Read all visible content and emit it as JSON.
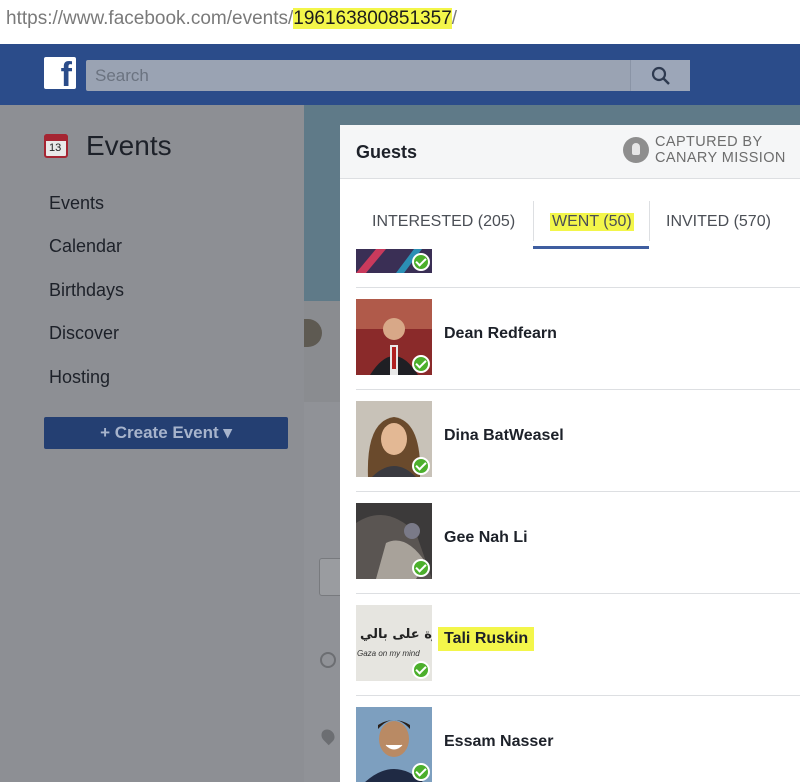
{
  "browser": {
    "url_prefix": "https://www.facebook.com/",
    "url_path": "events/",
    "url_id": "196163800851357",
    "url_suffix": "/"
  },
  "topbar": {
    "logo_letter": "f",
    "search_placeholder": "Search"
  },
  "sidebar": {
    "calendar_day": "13",
    "title": "Events",
    "items": [
      "Events",
      "Calendar",
      "Birthdays",
      "Discover",
      "Hosting"
    ],
    "create_button": "+ Create Event ▾"
  },
  "modal": {
    "title": "Guests",
    "stamp_line1": "CAPTURED BY",
    "stamp_line2": "CANARY MISSION",
    "tabs": [
      {
        "label": "INTERESTED (205)",
        "active": false
      },
      {
        "label": "WENT (50)",
        "active": true
      },
      {
        "label": "INVITED (570)",
        "active": false
      }
    ],
    "guests": [
      {
        "name": "Dean Redfearn"
      },
      {
        "name": "Dina BatWeasel"
      },
      {
        "name": "Gee Nah Li"
      },
      {
        "name": "Tali Ruskin",
        "highlighted": true,
        "avatar_text_ar": "غزة على بالي",
        "avatar_text_en": "Gaza on my mind"
      },
      {
        "name": "Essam Nasser"
      }
    ]
  },
  "colors": {
    "facebook_blue": "#2b4c8a",
    "highlight": "#f3f64a",
    "went_check": "#4caf2c",
    "active_tab": "#3f5ea0"
  }
}
